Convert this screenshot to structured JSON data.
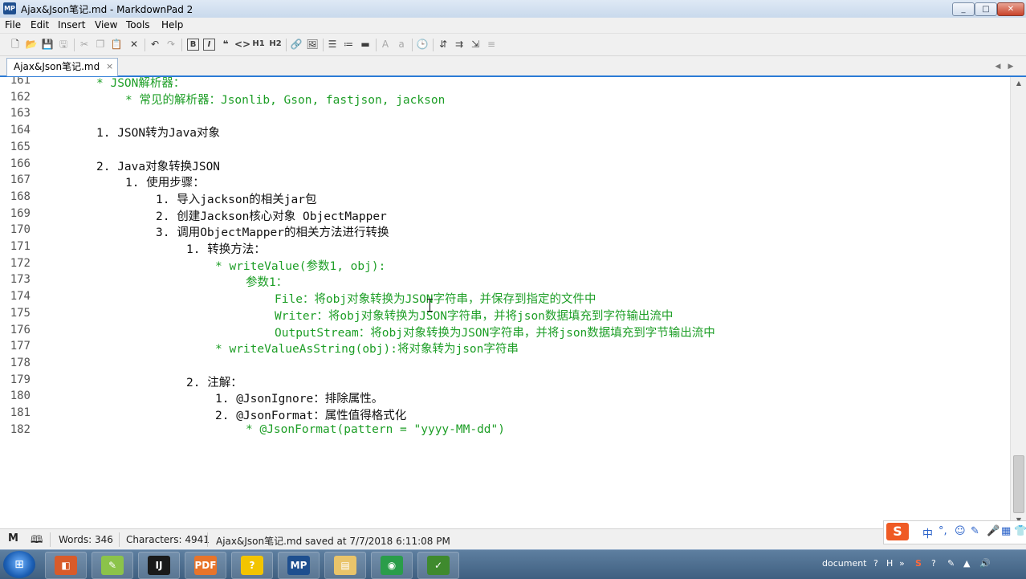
{
  "window": {
    "title": "Ajax&Json笔记.md - MarkdownPad 2",
    "app_icon_text": "MP",
    "controls": [
      "_",
      "□",
      "✕"
    ]
  },
  "menu": [
    "File",
    "Edit",
    "Insert",
    "View",
    "Tools",
    "Help"
  ],
  "toolbar": {
    "buttons": [
      "new-file",
      "open-file",
      "save",
      "save-all",
      "cut",
      "copy",
      "paste",
      "delete",
      "undo",
      "redo",
      "bold",
      "italic",
      "quote",
      "code",
      "H1",
      "H2",
      "link",
      "image",
      "unordered-list",
      "ordered-list",
      "horizontal-rule",
      "uppercase-A",
      "lowercase-a",
      "timestamp",
      "preview",
      "preview-split",
      "export"
    ]
  },
  "tab": {
    "label": "Ajax&Json笔记.md",
    "close": "×"
  },
  "editor": {
    "lines": [
      {
        "n": "161",
        "text": "* JSON解析器：",
        "indent": 68,
        "style": "green"
      },
      {
        "n": "162",
        "text": "* 常见的解析器：Jsonlib, Gson, fastjson, jackson",
        "indent": 104,
        "style": "green"
      },
      {
        "n": "163",
        "text": "",
        "indent": 0,
        "style": ""
      },
      {
        "n": "164",
        "text": "1. JSON转为Java对象",
        "indent": 68,
        "style": ""
      },
      {
        "n": "165",
        "text": "",
        "indent": 0,
        "style": ""
      },
      {
        "n": "166",
        "text": "2. Java对象转换JSON",
        "indent": 68,
        "style": ""
      },
      {
        "n": "167",
        "text": "1. 使用步骤：",
        "indent": 104,
        "style": ""
      },
      {
        "n": "168",
        "text": "1. 导入jackson的相关jar包",
        "indent": 142,
        "style": ""
      },
      {
        "n": "169",
        "text": "2. 创建Jackson核心对象 ObjectMapper",
        "indent": 142,
        "style": ""
      },
      {
        "n": "170",
        "text": "3. 调用ObjectMapper的相关方法进行转换",
        "indent": 142,
        "style": ""
      },
      {
        "n": "171",
        "text": "1. 转换方法：",
        "indent": 180,
        "style": ""
      },
      {
        "n": "172",
        "text": "* writeValue(参数1, obj):",
        "indent": 216,
        "style": "green"
      },
      {
        "n": "173",
        "text": "参数1：",
        "indent": 254,
        "style": "green"
      },
      {
        "n": "174",
        "text": "File：将obj对象转换为JSON字符串，并保存到指定的文件中",
        "indent": 290,
        "style": "green"
      },
      {
        "n": "175",
        "text": "Writer：将obj对象转换为JSON字符串，并将json数据填充到字符输出流中",
        "indent": 290,
        "style": "green"
      },
      {
        "n": "176",
        "text": "OutputStream：将obj对象转换为JSON字符串，并将json数据填充到字节输出流中",
        "indent": 290,
        "style": "green"
      },
      {
        "n": "177",
        "text": "* writeValueAsString(obj):将对象转为json字符串",
        "indent": 216,
        "style": "green"
      },
      {
        "n": "178",
        "text": "",
        "indent": 0,
        "style": ""
      },
      {
        "n": "179",
        "text": "2. 注解：",
        "indent": 180,
        "style": ""
      },
      {
        "n": "180",
        "text": "1. @JsonIgnore：排除属性。",
        "indent": 216,
        "style": ""
      },
      {
        "n": "181",
        "text": "2. @JsonFormat：属性值得格式化",
        "indent": 216,
        "style": ""
      },
      {
        "n": "182",
        "text": "* @JsonFormat(pattern = \"yyyy-MM-dd\")",
        "indent": 254,
        "style": "green"
      }
    ]
  },
  "status": {
    "words": "Words: 346",
    "characters": "Characters: 4941",
    "saved": "Ajax&Json笔记.md saved at 7/7/2018 6:11:08 PM"
  },
  "ime": {
    "logo": "S",
    "items": [
      "中",
      "°,",
      "☺",
      "✎",
      "🎤",
      "▦",
      "👕",
      "⚙"
    ]
  },
  "taskbar": {
    "apps": [
      {
        "name": "explorer-pinned",
        "glyph": "◧",
        "color": "#d85b2a"
      },
      {
        "name": "notepad-plus",
        "glyph": "✎",
        "color": "#8bc34a"
      },
      {
        "name": "intellij",
        "glyph": "IJ",
        "color": "#1a1a1a"
      },
      {
        "name": "pdf-reader",
        "glyph": "PDF",
        "color": "#e8742a"
      },
      {
        "name": "help",
        "glyph": "?",
        "color": "#f2c400"
      },
      {
        "name": "markdownpad",
        "glyph": "MP",
        "color": "#1e4f8f"
      },
      {
        "name": "file-explorer",
        "glyph": "▤",
        "color": "#e9c46a"
      },
      {
        "name": "chrome",
        "glyph": "◉",
        "color": "#2a9d4a"
      },
      {
        "name": "chart-app",
        "glyph": "✓",
        "color": "#3f8a2e"
      }
    ],
    "tray": {
      "document_label": "document",
      "items": [
        "?",
        "H",
        "»",
        "S",
        "?",
        "✎",
        "▲",
        "🔊"
      ]
    }
  }
}
